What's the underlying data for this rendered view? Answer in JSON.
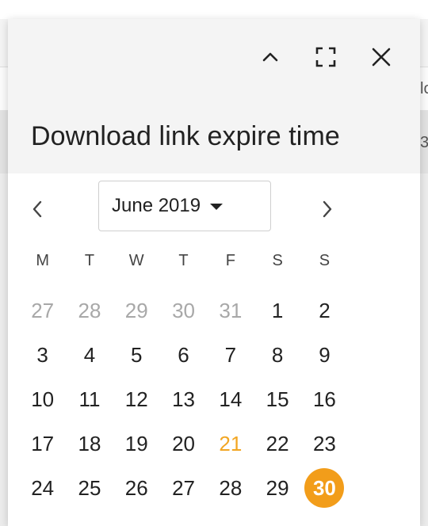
{
  "dialog": {
    "title": "Download link expire time"
  },
  "calendar": {
    "month_label": "June 2019",
    "weekdays": [
      "M",
      "T",
      "W",
      "T",
      "F",
      "S",
      "S"
    ],
    "days": [
      {
        "label": "27",
        "state": "muted"
      },
      {
        "label": "28",
        "state": "muted"
      },
      {
        "label": "29",
        "state": "muted"
      },
      {
        "label": "30",
        "state": "muted"
      },
      {
        "label": "31",
        "state": "muted"
      },
      {
        "label": "1",
        "state": "normal"
      },
      {
        "label": "2",
        "state": "normal"
      },
      {
        "label": "3",
        "state": "normal"
      },
      {
        "label": "4",
        "state": "normal"
      },
      {
        "label": "5",
        "state": "normal"
      },
      {
        "label": "6",
        "state": "normal"
      },
      {
        "label": "7",
        "state": "normal"
      },
      {
        "label": "8",
        "state": "normal"
      },
      {
        "label": "9",
        "state": "normal"
      },
      {
        "label": "10",
        "state": "normal"
      },
      {
        "label": "11",
        "state": "normal"
      },
      {
        "label": "12",
        "state": "normal"
      },
      {
        "label": "13",
        "state": "normal"
      },
      {
        "label": "14",
        "state": "normal"
      },
      {
        "label": "15",
        "state": "normal"
      },
      {
        "label": "16",
        "state": "normal"
      },
      {
        "label": "17",
        "state": "normal"
      },
      {
        "label": "18",
        "state": "normal"
      },
      {
        "label": "19",
        "state": "normal"
      },
      {
        "label": "20",
        "state": "normal"
      },
      {
        "label": "21",
        "state": "today"
      },
      {
        "label": "22",
        "state": "normal"
      },
      {
        "label": "23",
        "state": "normal"
      },
      {
        "label": "24",
        "state": "normal"
      },
      {
        "label": "25",
        "state": "normal"
      },
      {
        "label": "26",
        "state": "normal"
      },
      {
        "label": "27",
        "state": "normal"
      },
      {
        "label": "28",
        "state": "normal"
      },
      {
        "label": "29",
        "state": "normal"
      },
      {
        "label": "30",
        "state": "selected"
      }
    ]
  },
  "background": {
    "fragment_top": "lo",
    "fragment_row": "3"
  },
  "colors": {
    "accent": "#f29d1a",
    "today": "#f2a623",
    "muted_day": "#a8a8a8"
  },
  "icons": {
    "collapse": "chevron-up-icon",
    "fullscreen": "fullscreen-icon",
    "close": "close-icon",
    "prev": "chevron-left-icon",
    "next": "chevron-right-icon",
    "month_caret": "caret-down-icon"
  }
}
